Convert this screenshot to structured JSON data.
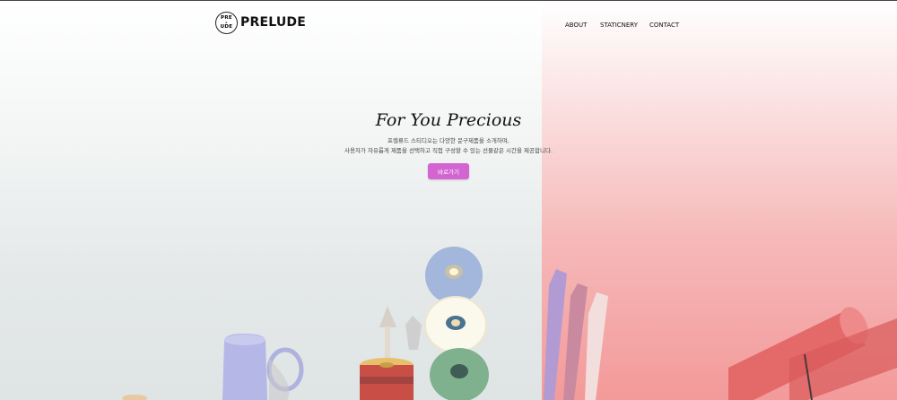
{
  "header": {
    "logo_line1": "PRE",
    "logo_line2": "L",
    "logo_line3": "UDE",
    "brand": "PRELUDE",
    "nav": [
      {
        "label": "ABOUT"
      },
      {
        "label": "STATICNERY"
      },
      {
        "label": "CONTACT"
      }
    ]
  },
  "hero": {
    "title": "For You Precious",
    "desc_line1": "프렐류드 스티디오는 다양한 문구제품을 소개하며,",
    "desc_line2": "사용자가 자유롭게 제품을 선택하고 직접 구성할 수 있는 선물같은 시간을 제공합니다.",
    "button": "바로가기"
  },
  "colors": {
    "accent": "#d265d2",
    "left_bg": "#e4e8e8",
    "right_bg": "#f39a9a"
  }
}
